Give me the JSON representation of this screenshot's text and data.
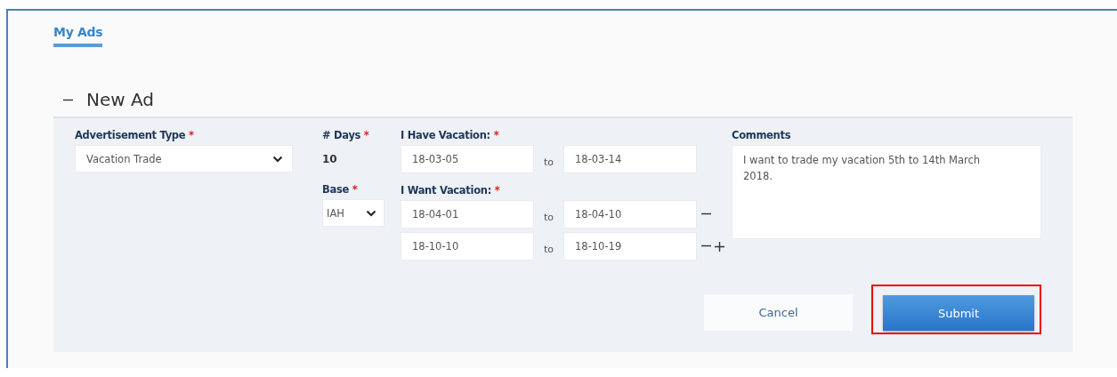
{
  "tab": {
    "label": "My Ads",
    "selected": true
  },
  "section": {
    "title": "New Ad",
    "expanded": true
  },
  "form": {
    "ad_type": {
      "label": "Advertisement Type",
      "required_mark": "*",
      "value": "Vacation Trade"
    },
    "days": {
      "label": "# Days",
      "required_mark": "*",
      "value": "10"
    },
    "base": {
      "label": "Base",
      "required_mark": "*",
      "value": "IAH"
    },
    "have": {
      "label": "I Have Vacation:",
      "required_mark": "*",
      "from": "18-03-05",
      "separator": "to",
      "to": "18-03-14"
    },
    "want": {
      "label": "I Want Vacation:",
      "required_mark": "*",
      "ranges": [
        {
          "from": "18-04-01",
          "separator": "to",
          "to": "18-04-10",
          "removable": true,
          "addable": false
        },
        {
          "from": "18-10-10",
          "separator": "to",
          "to": "18-10-19",
          "removable": true,
          "addable": true
        }
      ]
    },
    "comments": {
      "label": "Comments",
      "value": "I want to trade my vacation 5th to 14th March 2018."
    }
  },
  "buttons": [
    {
      "label": "Cancel",
      "kind": "secondary",
      "highlighted": false
    },
    {
      "label": "Submit",
      "kind": "primary",
      "highlighted": true
    }
  ]
}
